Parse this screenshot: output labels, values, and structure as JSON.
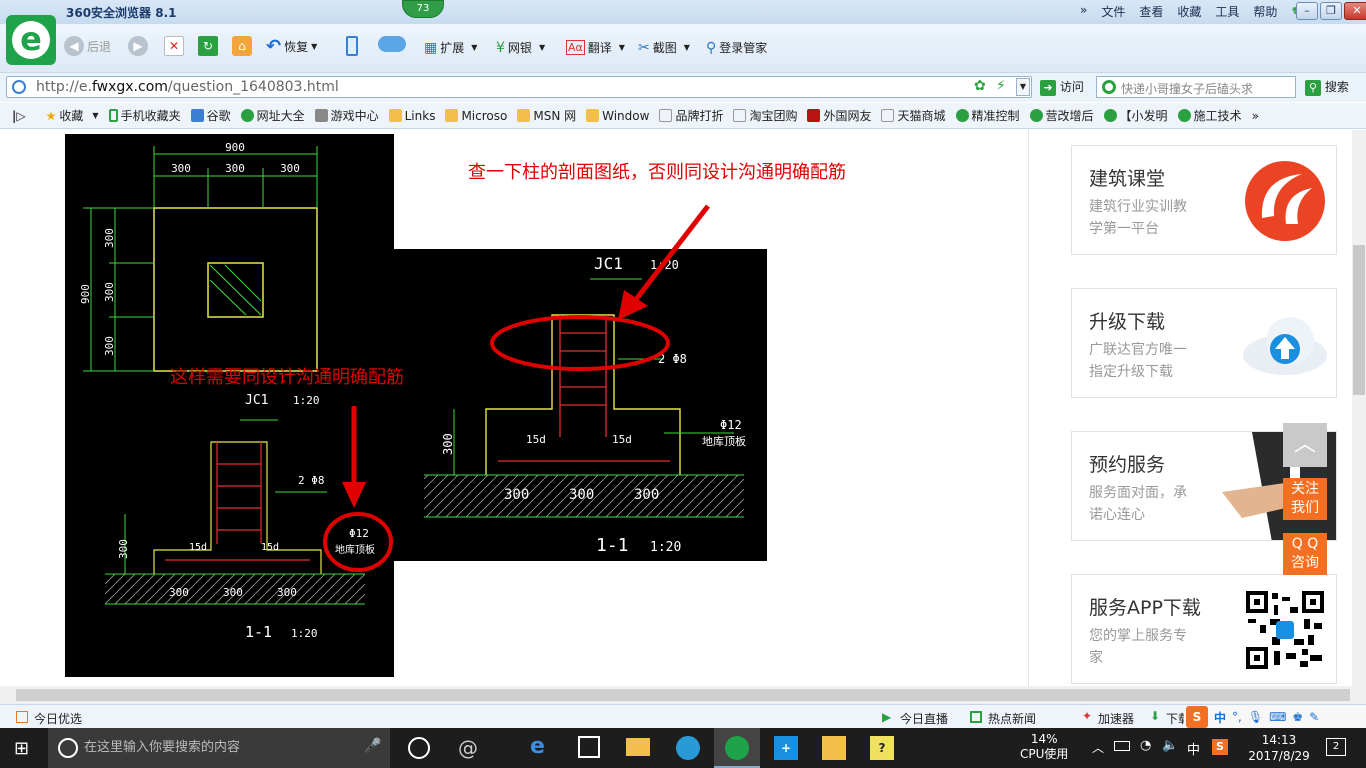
{
  "browser": {
    "app_title": "360安全浏览器 8.1",
    "badge": "73",
    "menu": [
      "文件",
      "查看",
      "收藏",
      "工具",
      "帮助"
    ],
    "toolbar": {
      "back": "后退",
      "restore": "恢复",
      "extend": "扩展",
      "bank": "网银",
      "translate": "翻译",
      "screenshot": "截图",
      "login_manager": "登录管家"
    },
    "address": {
      "url_prefix": "http://e.",
      "url_domain": "fwxgx.com",
      "url_path": "/question_1640803.html",
      "visit": "访问",
      "search_placeholder": "快递小哥撞女子后磕头求",
      "search_button": "搜索"
    },
    "favorites": [
      "收藏",
      "手机收藏夹",
      "谷歌",
      "网址大全",
      "游戏中心",
      "Links",
      "Microso",
      "MSN 网",
      "Window",
      "品牌打折",
      "淘宝团购",
      "外国网友",
      "天猫商城",
      "精准控制",
      "营改增后",
      "【小发明",
      "施工技术"
    ]
  },
  "drawing_left": {
    "dim_top": "900",
    "dims_top": [
      "300",
      "300",
      "300"
    ],
    "dim_left": "900",
    "dims_left": [
      "300",
      "300",
      "300"
    ],
    "section_title": "JC1",
    "section_scale": "1:20",
    "rebar_label": "2 Φ8",
    "mesh_label": "Φ12",
    "slab_label": "地库顶板",
    "hook_left": "15d",
    "hook_right": "15d",
    "height_dim": "300",
    "bottom_dims": [
      "300",
      "300",
      "300"
    ],
    "section_mark": "1-1",
    "section_mark_scale": "1:20"
  },
  "drawing_right": {
    "section_title": "JC1",
    "section_scale": "1:20",
    "rebar_label": "2 Φ8",
    "mesh_label": "Φ12",
    "slab_label": "地库顶板",
    "hook_left": "15d",
    "hook_right": "15d",
    "height_dim": "300",
    "bottom_dims": [
      "300",
      "300",
      "300"
    ],
    "section_mark": "1-1",
    "section_mark_scale": "1:20"
  },
  "annotations": {
    "note_top": "查一下柱的剖面图纸，否则同设计沟通明确配筋",
    "note_left": "这样需要同设计沟通明确配筋"
  },
  "sidebar": {
    "cards": [
      {
        "title": "建筑课堂",
        "sub1": "建筑行业实训教",
        "sub2": "学第一平台"
      },
      {
        "title": "升级下载",
        "sub1": "广联达官方唯一",
        "sub2": "指定升级下载"
      },
      {
        "title": "预约服务",
        "sub1": "服务面对面，承",
        "sub2": "诺心连心"
      },
      {
        "title": "服务APP下载",
        "sub1": "您的掌上服务专",
        "sub2": "家"
      }
    ],
    "follow_1": "关注",
    "follow_2": "我们",
    "qq_1": "Q Q",
    "qq_2": "咨询"
  },
  "status": {
    "left": "今日优选",
    "live": "今日直播",
    "hot_news": "热点新闻",
    "accelerator": "加速器",
    "download": "下载",
    "ime": "中"
  },
  "taskbar": {
    "search_placeholder": "在这里输入你要搜索的内容",
    "cpu_percent": "14%",
    "cpu_label": "CPU使用",
    "ime": "中",
    "time": "14:13",
    "date": "2017/8/29",
    "notifications": "2"
  },
  "colors": {
    "accent_green": "#1fa34a",
    "annotation_red": "#e00000",
    "cad_green": "#3ddc3d",
    "cad_yellow": "#e6e64a",
    "cad_red": "#e03030",
    "float_orange": "#f36f21"
  }
}
